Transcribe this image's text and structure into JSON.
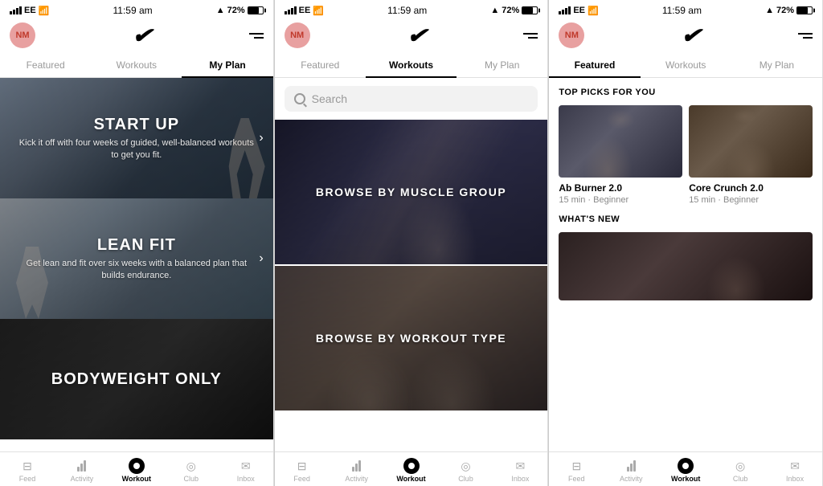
{
  "panels": [
    {
      "id": "panel1",
      "statusBar": {
        "carrier": "EE",
        "time": "11:59 am",
        "signal_text": "▲",
        "battery_pct": "72%"
      },
      "header": {
        "avatar_initials": "NM",
        "menu_label": "☰"
      },
      "tabs": [
        {
          "label": "Featured",
          "active": false
        },
        {
          "label": "Workouts",
          "active": false
        },
        {
          "label": "My Plan",
          "active": true
        }
      ],
      "cards": [
        {
          "title": "START UP",
          "desc": "Kick it off with four weeks of guided, well-balanced workouts to get you fit.",
          "bg_class": "card-bg-1"
        },
        {
          "title": "LEAN FIT",
          "desc": "Get lean and fit over six weeks with a balanced plan that builds endurance.",
          "bg_class": "card-bg-2"
        },
        {
          "title": "BODYWEIGHT ONLY",
          "desc": "",
          "bg_class": "card-bg-3"
        }
      ],
      "bottomNav": [
        {
          "label": "Feed",
          "active": false,
          "type": "feed"
        },
        {
          "label": "Activity",
          "active": false,
          "type": "activity"
        },
        {
          "label": "Workout",
          "active": true,
          "type": "workout"
        },
        {
          "label": "Club",
          "active": false,
          "type": "club"
        },
        {
          "label": "Inbox",
          "active": false,
          "type": "inbox"
        }
      ]
    },
    {
      "id": "panel2",
      "statusBar": {
        "carrier": "EE",
        "time": "11:59 am",
        "battery_pct": "72%"
      },
      "header": {
        "avatar_initials": "NM"
      },
      "tabs": [
        {
          "label": "Featured",
          "active": false
        },
        {
          "label": "Workouts",
          "active": true
        },
        {
          "label": "My Plan",
          "active": false
        }
      ],
      "search": {
        "placeholder": "Search"
      },
      "browseCards": [
        {
          "title": "BROWSE BY MUSCLE GROUP",
          "bg_class": "browse-bg-1",
          "athlete_class": "browse-athlete-kick"
        },
        {
          "title": "BROWSE BY WORKOUT TYPE",
          "bg_class": "browse-bg-2",
          "athlete_class": "browse-athlete-weights"
        }
      ],
      "bottomNav": [
        {
          "label": "Feed",
          "active": false,
          "type": "feed"
        },
        {
          "label": "Activity",
          "active": false,
          "type": "activity"
        },
        {
          "label": "Workout",
          "active": true,
          "type": "workout"
        },
        {
          "label": "Club",
          "active": false,
          "type": "club"
        },
        {
          "label": "Inbox",
          "active": false,
          "type": "inbox"
        }
      ]
    },
    {
      "id": "panel3",
      "statusBar": {
        "carrier": "EE",
        "time": "11:59 am",
        "battery_pct": "72%"
      },
      "header": {
        "avatar_initials": "NM"
      },
      "tabs": [
        {
          "label": "Featured",
          "active": true
        },
        {
          "label": "Workouts",
          "active": false
        },
        {
          "label": "My Plan",
          "active": false
        }
      ],
      "sections": [
        {
          "title": "TOP PICKS FOR YOU",
          "picks": [
            {
              "name": "Ab Burner 2.0",
              "meta": "15 min · Beginner",
              "bg_class": "pick-img-1",
              "athlete_class": "pick-athlete-1"
            },
            {
              "name": "Core Crunch 2.0",
              "meta": "15 min · Beginner",
              "bg_class": "pick-img-2",
              "athlete_class": "pick-athlete-2"
            }
          ]
        },
        {
          "title": "WHAT'S NEW",
          "newItem": {
            "bg_class": "whats-new-img"
          }
        }
      ],
      "bottomNav": [
        {
          "label": "Feed",
          "active": false,
          "type": "feed"
        },
        {
          "label": "Activity",
          "active": false,
          "type": "activity"
        },
        {
          "label": "Workout",
          "active": true,
          "type": "workout"
        },
        {
          "label": "Club",
          "active": false,
          "type": "club"
        },
        {
          "label": "Inbox",
          "active": false,
          "type": "inbox"
        }
      ]
    }
  ]
}
